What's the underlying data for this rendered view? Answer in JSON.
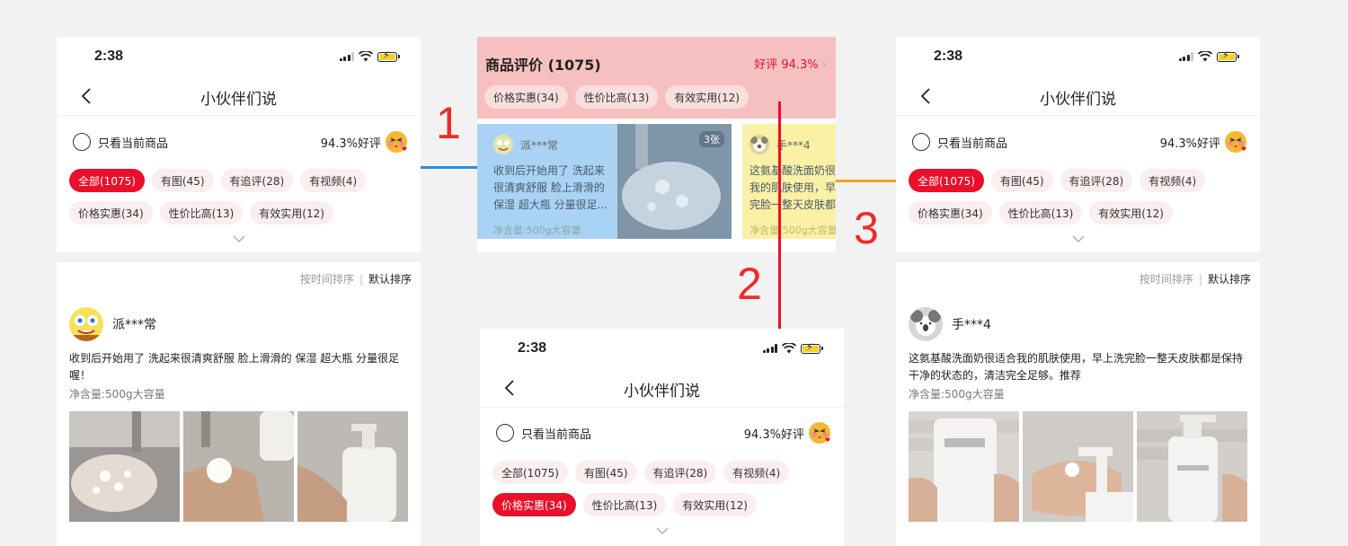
{
  "left_screen": {
    "status_time": "2:38",
    "nav_title": "小伙伴们说",
    "only_current_label": "只看当前商品",
    "rating_label": "94.3%好评",
    "tags_row1": [
      "全部(1075)",
      "有图(45)",
      "有追评(28)",
      "有视频(4)"
    ],
    "tags_row2": [
      "价格实惠(34)",
      "性价比高(13)",
      "有效实用(12)"
    ],
    "active_tag": "全部(1075)",
    "sort_by_time": "按时间排序",
    "sort_divider": "|",
    "sort_default": "默认排序",
    "review": {
      "username": "派***常",
      "text": "收到后开始用了 洗起来很清爽舒服 脸上滑滑的 保湿 超大瓶 分量很足喔！",
      "meta": "净含量:500g大容量"
    }
  },
  "right_screen": {
    "status_time": "2:38",
    "nav_title": "小伙伴们说",
    "only_current_label": "只看当前商品",
    "rating_label": "94.3%好评",
    "tags_row1": [
      "全部(1075)",
      "有图(45)",
      "有追评(28)",
      "有视频(4)"
    ],
    "tags_row2": [
      "价格实惠(34)",
      "性价比高(13)",
      "有效实用(12)"
    ],
    "active_tag": "全部(1075)",
    "sort_by_time": "按时间排序",
    "sort_divider": "|",
    "sort_default": "默认排序",
    "review": {
      "username": "手***4",
      "text": "这氨基酸洗面奶很适合我的肌肤使用，早上洗完脸一整天皮肤都是保持干净的状态的，清洁完全足够。推荐",
      "meta": "净含量:500g大容量"
    }
  },
  "bottom_screen": {
    "status_time": "2:38",
    "nav_title": "小伙伴们说",
    "only_current_label": "只看当前商品",
    "rating_label": "94.3%好评",
    "tags_row1": [
      "全部(1075)",
      "有图(45)",
      "有追评(28)",
      "有视频(4)"
    ],
    "tags_row2": [
      "价格实惠(34)",
      "性价比高(13)",
      "有效实用(12)"
    ],
    "active_tag": "价格实惠(34)"
  },
  "product_review_card": {
    "title": "商品评价 (1075)",
    "good_rate": "好评 94.3%",
    "tags": [
      "价格实惠(34)",
      "性价比高(13)",
      "有效实用(12)"
    ],
    "review1": {
      "username": "派***常",
      "text_lines": [
        "收到后开始用了 洗起来",
        "很清爽舒服 脸上滑滑的",
        "保湿 超大瓶 分量很足..."
      ],
      "meta": "净含量:500g大容量",
      "photo_badge": "3张"
    },
    "review2": {
      "username": "手***4",
      "text_lines": [
        "这氨基酸洗面奶很",
        "我的肌肤使用，早",
        "完脸一整天皮肤都"
      ],
      "meta": "净含量:500g大容量"
    }
  },
  "annotations": {
    "one": "1",
    "two": "2",
    "three": "3"
  },
  "colors": {
    "accent_red": "#e8102a",
    "highlight_pink": "#f7c0c0",
    "highlight_blue": "#a9d2f5",
    "highlight_yellow": "#faf0a6",
    "connector_blue": "#2a8fe0",
    "connector_orange": "#f3a020"
  }
}
